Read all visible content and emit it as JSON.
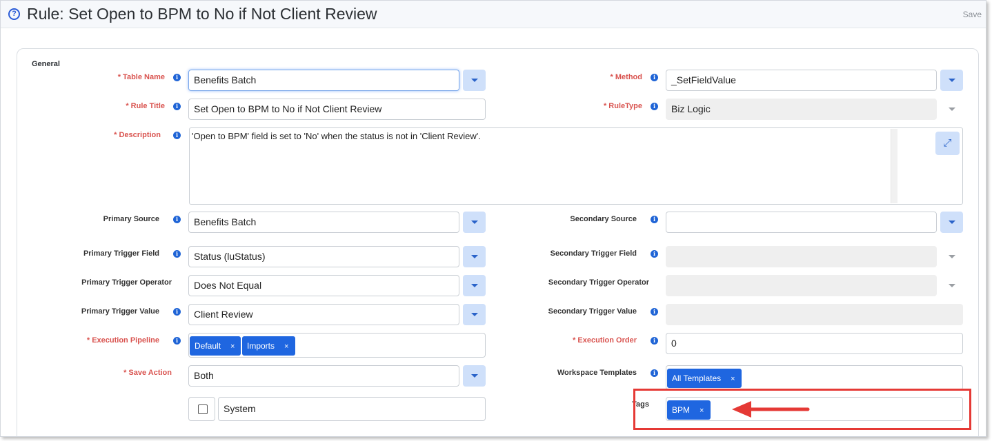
{
  "header": {
    "title": "Rule: Set Open to BPM to No if Not Client Review",
    "save_label": "Save"
  },
  "section": {
    "title": "General"
  },
  "left": {
    "table_name": {
      "label": "* Table Name",
      "value": "Benefits Batch"
    },
    "rule_title": {
      "label": "* Rule Title",
      "value": "Set Open to BPM to No if Not Client Review"
    },
    "description": {
      "label": "* Description",
      "value": "'Open to BPM' field is set to 'No' when the status is not in 'Client Review'."
    },
    "primary_source": {
      "label": "Primary Source",
      "value": "Benefits Batch"
    },
    "primary_trigger_field": {
      "label": "Primary Trigger Field",
      "value": "Status (luStatus)"
    },
    "primary_trigger_operator": {
      "label": "Primary Trigger Operator",
      "value": "Does Not Equal"
    },
    "primary_trigger_value": {
      "label": "Primary Trigger Value",
      "value": "Client Review"
    },
    "execution_pipeline": {
      "label": "* Execution Pipeline",
      "chips": [
        "Default",
        "Imports"
      ]
    },
    "save_action": {
      "label": "* Save Action",
      "value": "Both"
    },
    "system": {
      "value": "System",
      "checked": false
    }
  },
  "right": {
    "method": {
      "label": "* Method",
      "value": "_SetFieldValue"
    },
    "rule_type": {
      "label": "* RuleType",
      "value": "Biz Logic"
    },
    "secondary_source": {
      "label": "Secondary Source",
      "value": ""
    },
    "secondary_trigger_field": {
      "label": "Secondary Trigger Field",
      "value": ""
    },
    "secondary_trigger_operator": {
      "label": "Secondary Trigger Operator",
      "value": ""
    },
    "secondary_trigger_value": {
      "label": "Secondary Trigger Value",
      "value": ""
    },
    "execution_order": {
      "label": "* Execution Order",
      "value": "0"
    },
    "workspace_templates": {
      "label": "Workspace Templates",
      "chips": [
        "All Templates"
      ]
    },
    "tags": {
      "label": "Tags",
      "chips": [
        "BPM"
      ]
    }
  },
  "icons": {
    "help": "help-circle-icon",
    "info": "info-icon",
    "expand": "expand-icon",
    "dropdown": "chevron-down-icon",
    "remove": "close-icon",
    "annotation": "arrow-left-icon"
  },
  "colors": {
    "required_label": "#d9534f",
    "chip": "#1f66e0",
    "dropdown_button": "#cfe0fa",
    "highlight": "#e53935"
  }
}
